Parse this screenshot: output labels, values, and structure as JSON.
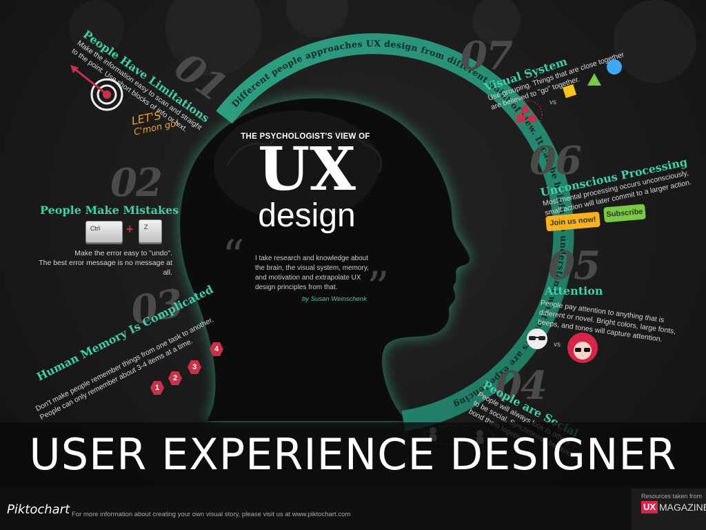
{
  "arc_text": "Different people approaches UX design from different point of view.  It can be helpful to understand what others are experiencing",
  "center": {
    "kicker": "THE PSYCHOLOGIST'S VIEW OF",
    "big": "UX",
    "sub": "design",
    "quote": "I take research and knowledge about the brain, the visual system, memory, and motivation and extrapolate UX design principles from that.",
    "quote_line1": "I take research and knowledge about",
    "quote_line2": "the brain, the visual system, memory,",
    "quote_line3": "and motivation and extrapolate UX",
    "quote_line4": "design principles from that.",
    "author": "by Susan Weinschenk"
  },
  "sections": {
    "s01": {
      "num": "01",
      "title": "People Have Limitations",
      "line1": "Make the information easy to scan and straight",
      "line2": "to the point. Use short blocks of info or text.",
      "note1": "LET'S",
      "note2": "C'mon go!"
    },
    "s02": {
      "num": "02",
      "title": "People Make Mistakes",
      "key1": "Ctrl",
      "plus": "+",
      "key2": "Z",
      "line1": "Make the error easy to \"undo\".",
      "line2": "The best error message is no message at all."
    },
    "s03": {
      "num": "03",
      "title": "Human Memory Is Complicated",
      "line1": "Don't make people remember things from one task to another.",
      "line2": "People can only remember about 3-4 items at a time.",
      "items": [
        "1",
        "2",
        "3",
        "4"
      ]
    },
    "s04": {
      "num": "04",
      "title": "People are Social",
      "line1": "People will always look to others",
      "line2": "to be social. Synchronous behavior",
      "line3": "bond them together."
    },
    "s05": {
      "num": "05",
      "title": "Attention",
      "line1": "People pay attention to anything that is",
      "line2": "different or novel. Bright colors, large fonts,",
      "line3": "beeps, and tones will capture attention.",
      "vs": "vs"
    },
    "s06": {
      "num": "06",
      "title": "Unconscious Processing",
      "line1": "Most mental processing occurs unconsciously,",
      "line2": "small action will later commit to a larger action.",
      "btn1": "Join us now!",
      "btn2": "Subscribe"
    },
    "s07": {
      "num": "07",
      "title": "Visual System",
      "line1": "Use grouping. Things that are close together",
      "line2": "are believed to \"go\" together.",
      "vs": "vs"
    }
  },
  "banner": {
    "text": "USER EXPERIENCE DESIGNER"
  },
  "footer": {
    "logo": "Piktochart",
    "info": "For more information about creating your own visual story, please visit us at www.piktochart.com",
    "resources": "Resources taken from",
    "ux_badge": "UX",
    "magazine": "MAGAZINE"
  },
  "colors": {
    "teal": "#3fd1ab",
    "red": "#c9304a",
    "orange": "#f0a020",
    "green": "#7ac943",
    "blue": "#3fa9f5",
    "yellow": "#f7c51e"
  },
  "icons": [
    "target-icon",
    "ctrl-key-icon",
    "z-key-icon",
    "hexagon-number-icon",
    "people-icon",
    "glasses-face-icon",
    "red-hair-face-icon",
    "shapes-group-icon",
    "square-icon",
    "triangle-icon",
    "circle-icon"
  ]
}
